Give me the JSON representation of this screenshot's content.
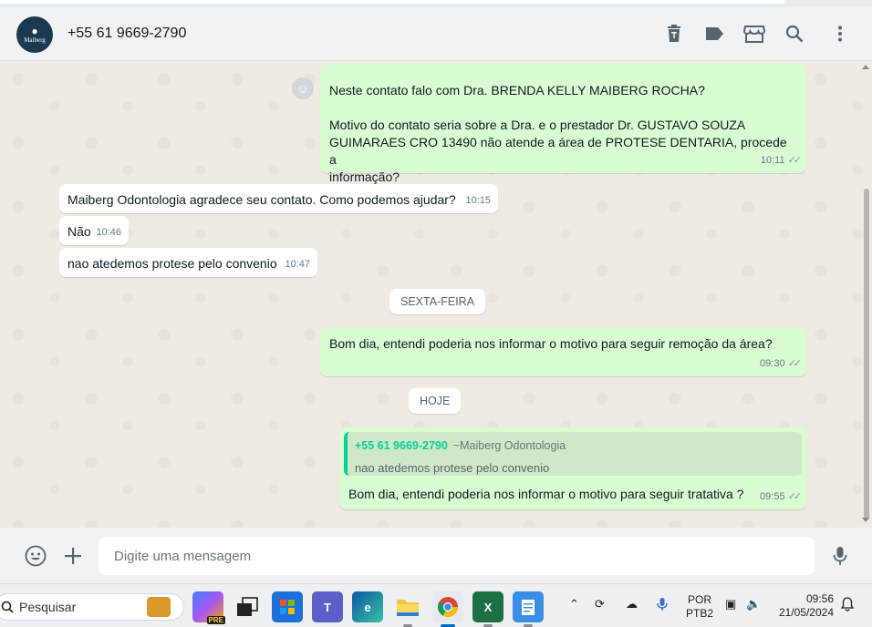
{
  "header": {
    "avatar_brand": "Maiberg",
    "contact": "+55 61 9669-2790"
  },
  "messages": [
    {
      "dir": "out",
      "lines": [
        "Neste contato falo com Dra. BRENDA KELLY MAIBERG ROCHA?",
        "",
        "Motivo do contato seria sobre a Dra. e o prestador Dr. GUSTAVO SOUZA",
        "GUIMARAES  CRO 13490 não atende a área de PROTESE DENTARIA, procede a",
        "informação?"
      ],
      "time": "10:11"
    },
    {
      "dir": "in",
      "text": "Maiberg Odontologia agradece seu contato. Como podemos ajudar?",
      "time": "10:15"
    },
    {
      "dir": "in",
      "text": "Não",
      "time": "10:46"
    },
    {
      "dir": "in",
      "text": "nao atedemos protese pelo convenio",
      "time": "10:47"
    },
    {
      "dir": "out",
      "text": "Bom dia, entendi poderia nos informar o motivo para seguir remoção da área?",
      "time": "09:30"
    },
    {
      "dir": "out",
      "quote_name": "+55 61 9669-2790",
      "quote_alias": "~Maiberg Odontologia",
      "quote_text": "nao atedemos protese pelo convenio",
      "text": "Bom dia, entendi poderia nos informar o motivo para seguir tratativa ?",
      "time": "09:55"
    }
  ],
  "day_separators": [
    "SEXTA-FEIRA",
    "HOJE"
  ],
  "composer": {
    "placeholder": "Digite uma mensagem"
  },
  "taskbar": {
    "search_label": "Pesquisar",
    "lang_top": "POR",
    "lang_bottom": "PTB2",
    "time": "09:56",
    "date": "21/05/2024",
    "badge_pre": "PRE"
  },
  "colors": {
    "outgoing": "#d9fdd3",
    "incoming": "#ffffff",
    "quote_accent": "#06cf9c",
    "chat_bg": "#efeae2"
  },
  "icons": [
    "trash-icon",
    "label-icon",
    "store-icon",
    "search-icon",
    "menu-icon",
    "emoji-icon",
    "plus-icon",
    "mic-icon"
  ]
}
